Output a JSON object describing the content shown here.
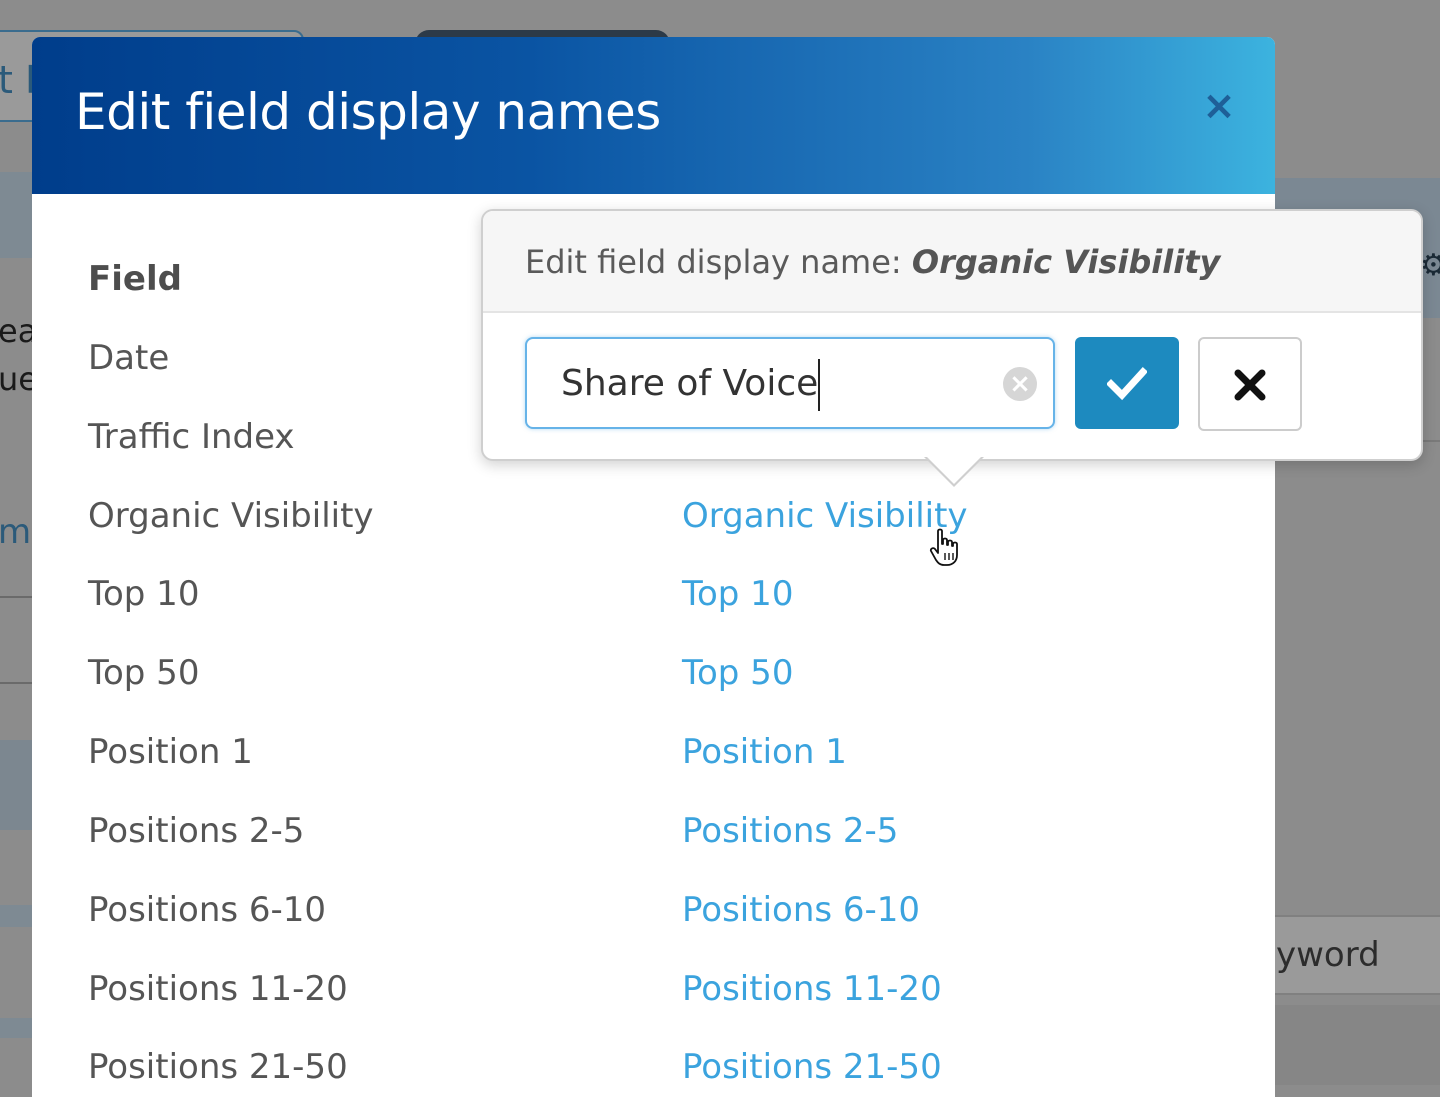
{
  "background": {
    "left_snippets": [
      "t F",
      "ea",
      "ue",
      "m"
    ],
    "right_snippet": "yword",
    "gear": "⚙"
  },
  "modal": {
    "title": "Edit field display names",
    "close_symbol": "×",
    "column_header": "Field",
    "rows": [
      {
        "field": "Date",
        "display": ""
      },
      {
        "field": "Traffic Index",
        "display": ""
      },
      {
        "field": "Organic Visibility",
        "display": "Organic Visibility"
      },
      {
        "field": "Top 10",
        "display": "Top 10"
      },
      {
        "field": "Top 50",
        "display": "Top 50"
      },
      {
        "field": "Position 1",
        "display": "Position 1"
      },
      {
        "field": "Positions 2-5",
        "display": "Positions 2-5"
      },
      {
        "field": "Positions 6-10",
        "display": "Positions 6-10"
      },
      {
        "field": "Positions 11-20",
        "display": "Positions 11-20"
      },
      {
        "field": "Positions 21-50",
        "display": "Positions 21-50"
      }
    ]
  },
  "popover": {
    "title_prefix": "Edit field display name: ",
    "field_name": "Organic Visibility",
    "input_value": "Share of Voice",
    "clear_symbol": "×",
    "confirm_icon": "check-icon",
    "cancel_icon": "close-icon",
    "colors": {
      "confirm": "#1d8abf",
      "focus": "#66b3e8",
      "link": "#3ba3de"
    }
  }
}
